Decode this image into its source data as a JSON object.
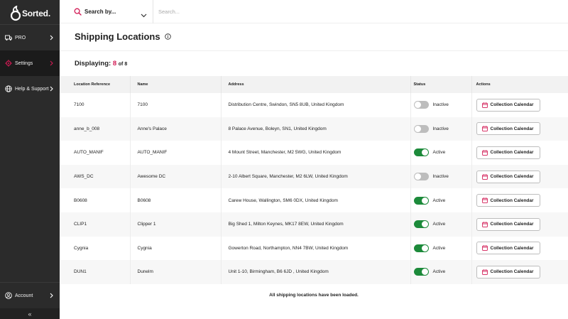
{
  "brand": {
    "name": "Sorted",
    "mark": ".",
    "accent": "#d21a54"
  },
  "sidebar": {
    "items": [
      {
        "label": "PRO",
        "icon": "truck-icon"
      },
      {
        "label": "Settings",
        "icon": "gear-icon"
      },
      {
        "label": "Help & Support",
        "icon": "globe-icon"
      }
    ],
    "account": {
      "label": "Account",
      "icon": "user-icon"
    },
    "collapse": "«"
  },
  "search": {
    "select_label": "Search by...",
    "placeholder": "Search..."
  },
  "page": {
    "title": "Shipping Locations",
    "displaying_label": "Displaying:",
    "displaying_count": "8",
    "displaying_of": "of 8"
  },
  "table": {
    "headers": [
      "Location Reference",
      "Name",
      "Address",
      "Status",
      "Actions"
    ],
    "action_label": "Collection Calendar",
    "rows": [
      {
        "ref": "7100",
        "name": "7100",
        "address": "Distribution Centre, Swindon, SN5 8UB, United Kingdom",
        "status": "Inactive",
        "active": false
      },
      {
        "ref": "anne_b_008",
        "name": "Anne's Palace",
        "address": "8 Palace Avenue, Boleyn, SN1, United Kingdom",
        "status": "Inactive",
        "active": false
      },
      {
        "ref": "AUTO_MANIF",
        "name": "AUTO_MANIF",
        "address": "4 Mount Street, Manchester, M2 5WG, United Kingdom",
        "status": "Active",
        "active": true
      },
      {
        "ref": "AWS_DC",
        "name": "Awesome DC",
        "address": "2-10 Albert Square, Manchester, M2 6LW, United Kingdom",
        "status": "Inactive",
        "active": false
      },
      {
        "ref": "B0608",
        "name": "B0608",
        "address": "Carew House, Wallington, SM6 0DX, United Kingdom",
        "status": "Active",
        "active": true
      },
      {
        "ref": "CLIP1",
        "name": "Clipper 1",
        "address": "Big Shed 1, Milton Keynes, MK17 8EW, United Kingdom",
        "status": "Active",
        "active": true
      },
      {
        "ref": "Cygnia",
        "name": "Cygnia",
        "address": "Gowerton Road, Northampton, NN4 7BW, United Kingdom",
        "status": "Active",
        "active": true
      },
      {
        "ref": "DUN1",
        "name": "Dunelm",
        "address": "Unit 1-10, Birmingham, B6 6JD , United Kingdom",
        "status": "Active",
        "active": true
      }
    ]
  },
  "footer": {
    "loaded_message": "All shipping locations have been loaded."
  }
}
